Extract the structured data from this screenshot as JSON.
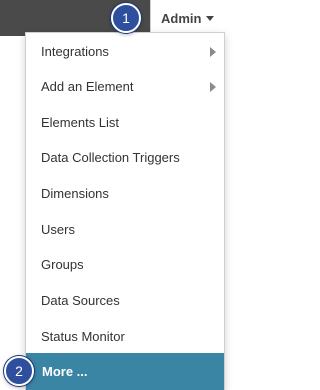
{
  "header": {
    "admin_label": "Admin"
  },
  "menu": {
    "items": [
      {
        "label": "Integrations",
        "has_submenu": true
      },
      {
        "label": "Add an Element",
        "has_submenu": true
      },
      {
        "label": "Elements List",
        "has_submenu": false
      },
      {
        "label": "Data Collection Triggers",
        "has_submenu": false
      },
      {
        "label": "Dimensions",
        "has_submenu": false
      },
      {
        "label": "Users",
        "has_submenu": false
      },
      {
        "label": "Groups",
        "has_submenu": false
      },
      {
        "label": "Data Sources",
        "has_submenu": false
      },
      {
        "label": "Status Monitor",
        "has_submenu": false
      },
      {
        "label": "More ...",
        "has_submenu": false,
        "highlighted": true
      }
    ]
  },
  "callouts": [
    {
      "number": "1"
    },
    {
      "number": "2"
    }
  ],
  "colors": {
    "header_dark": "#4a4a4a",
    "highlight": "#3a84a4",
    "badge": "#2d4f9e"
  }
}
